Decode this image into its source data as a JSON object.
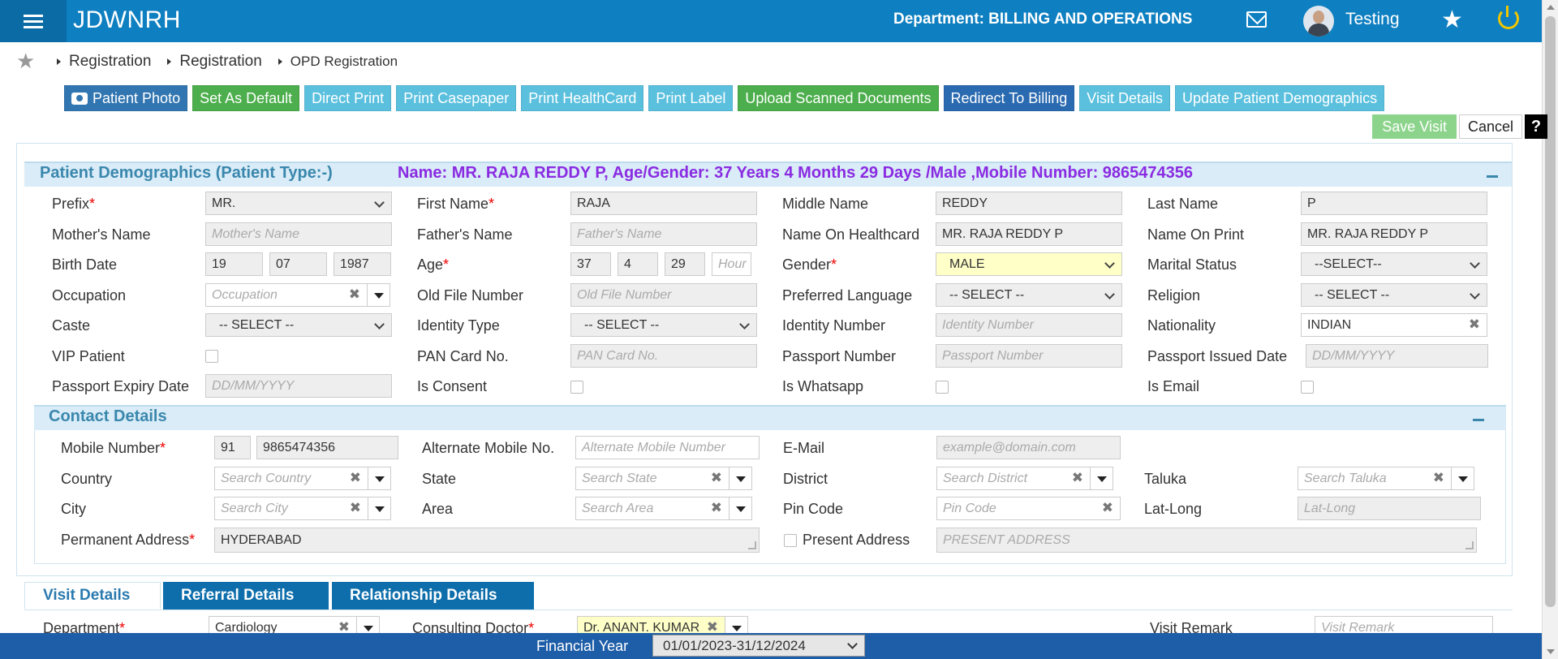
{
  "app": {
    "title": "JDWNRH",
    "department_label": "Department: BILLING AND OPERATIONS",
    "user_name": "Testing"
  },
  "breadcrumb": {
    "items": [
      "Registration",
      "Registration"
    ],
    "current": "OPD Registration"
  },
  "toolbar": {
    "patient_photo": "Patient Photo",
    "set_default": "Set As Default",
    "direct_print": "Direct Print",
    "print_casepaper": "Print Casepaper",
    "print_healthcard": "Print HealthCard",
    "print_label": "Print Label",
    "upload_docs": "Upload Scanned Documents",
    "redirect_billing": "Redirect To Billing",
    "visit_details": "Visit Details",
    "update_demographics": "Update Patient Demographics",
    "save_visit": "Save Visit",
    "cancel": "Cancel",
    "help": "?"
  },
  "demographics": {
    "title": "Patient Demographics (Patient Type:-)",
    "info": "Name: MR. RAJA REDDY P, Age/Gender: 37 Years 4 Months 29 Days /Male ,Mobile Number: 9865474356",
    "labels": {
      "prefix": "Prefix",
      "first_name": "First Name",
      "middle_name": "Middle Name",
      "last_name": "Last Name",
      "mother_name": "Mother's Name",
      "father_name": "Father's Name",
      "name_healthcard": "Name On Healthcard",
      "name_print": "Name On Print",
      "birth_date": "Birth Date",
      "age": "Age",
      "gender": "Gender",
      "marital_status": "Marital Status",
      "occupation": "Occupation",
      "old_file": "Old File Number",
      "pref_lang": "Preferred Language",
      "religion": "Religion",
      "caste": "Caste",
      "identity_type": "Identity Type",
      "identity_number": "Identity Number",
      "nationality": "Nationality",
      "vip": "VIP Patient",
      "pan": "PAN Card No.",
      "passport_no": "Passport Number",
      "passport_issued": "Passport Issued Date",
      "passport_expiry": "Passport Expiry Date",
      "consent": "Is Consent",
      "whatsapp": "Is Whatsapp",
      "email": "Is Email"
    },
    "values": {
      "prefix": "MR.",
      "first_name": "RAJA",
      "middle_name": "REDDY",
      "last_name": "P",
      "name_healthcard": "MR. RAJA REDDY P",
      "name_print": "MR. RAJA REDDY P",
      "birth_day": "19",
      "birth_month": "07",
      "birth_year": "1987",
      "age_years": "37",
      "age_months": "4",
      "age_days": "29",
      "gender": "MALE",
      "marital_status": "--SELECT--",
      "pref_lang": "-- SELECT --",
      "religion": "-- SELECT --",
      "caste": "-- SELECT --",
      "identity_type": "-- SELECT --",
      "nationality": "INDIAN"
    },
    "placeholders": {
      "mother_name": "Mother's Name",
      "father_name": "Father's Name",
      "age_hours": "Hour",
      "occupation": "Occupation",
      "old_file": "Old File Number",
      "identity_number": "Identity Number",
      "pan": "PAN Card No.",
      "passport_no": "Passport Number",
      "passport_issued": "DD/MM/YYYY",
      "passport_expiry": "DD/MM/YYYY"
    }
  },
  "contact": {
    "title": "Contact Details",
    "labels": {
      "mobile": "Mobile Number",
      "alt_mobile": "Alternate Mobile No.",
      "email": "E-Mail",
      "country": "Country",
      "state": "State",
      "district": "District",
      "taluka": "Taluka",
      "city": "City",
      "area": "Area",
      "pin": "Pin Code",
      "latlong": "Lat-Long",
      "perm_address": "Permanent Address",
      "present_address": "Present Address"
    },
    "values": {
      "mobile_code": "91",
      "mobile": "9865474356",
      "perm_address": "HYDERABAD"
    },
    "placeholders": {
      "alt_mobile": "Alternate Mobile Number",
      "email": "example@domain.com",
      "country": "Search Country",
      "state": "Search State",
      "district": "Search District",
      "taluka": "Search Taluka",
      "city": "Search City",
      "area": "Search Area",
      "pin": "Pin Code",
      "latlong": "Lat-Long",
      "present_address": "PRESENT ADDRESS"
    }
  },
  "tabs": {
    "visit": "Visit Details",
    "referral": "Referral Details",
    "relationship": "Relationship Details"
  },
  "visit": {
    "labels": {
      "department": "Department",
      "consulting_doctor": "Consulting Doctor",
      "visit_remark": "Visit Remark"
    },
    "values": {
      "department": "Cardiology",
      "consulting_doctor": "Dr. ANANT. KUMAR"
    },
    "placeholders": {
      "visit_remark": "Visit Remark"
    }
  },
  "footer": {
    "financial_year_label": "Financial Year",
    "financial_year": "01/01/2023-31/12/2024"
  },
  "colors": {
    "topbar": "#0e7fc0",
    "primary": "#3276b1",
    "success": "#4cae4c",
    "info": "#5bc0de",
    "accent_text": "#8a2be2",
    "footer": "#1e5ea8"
  }
}
